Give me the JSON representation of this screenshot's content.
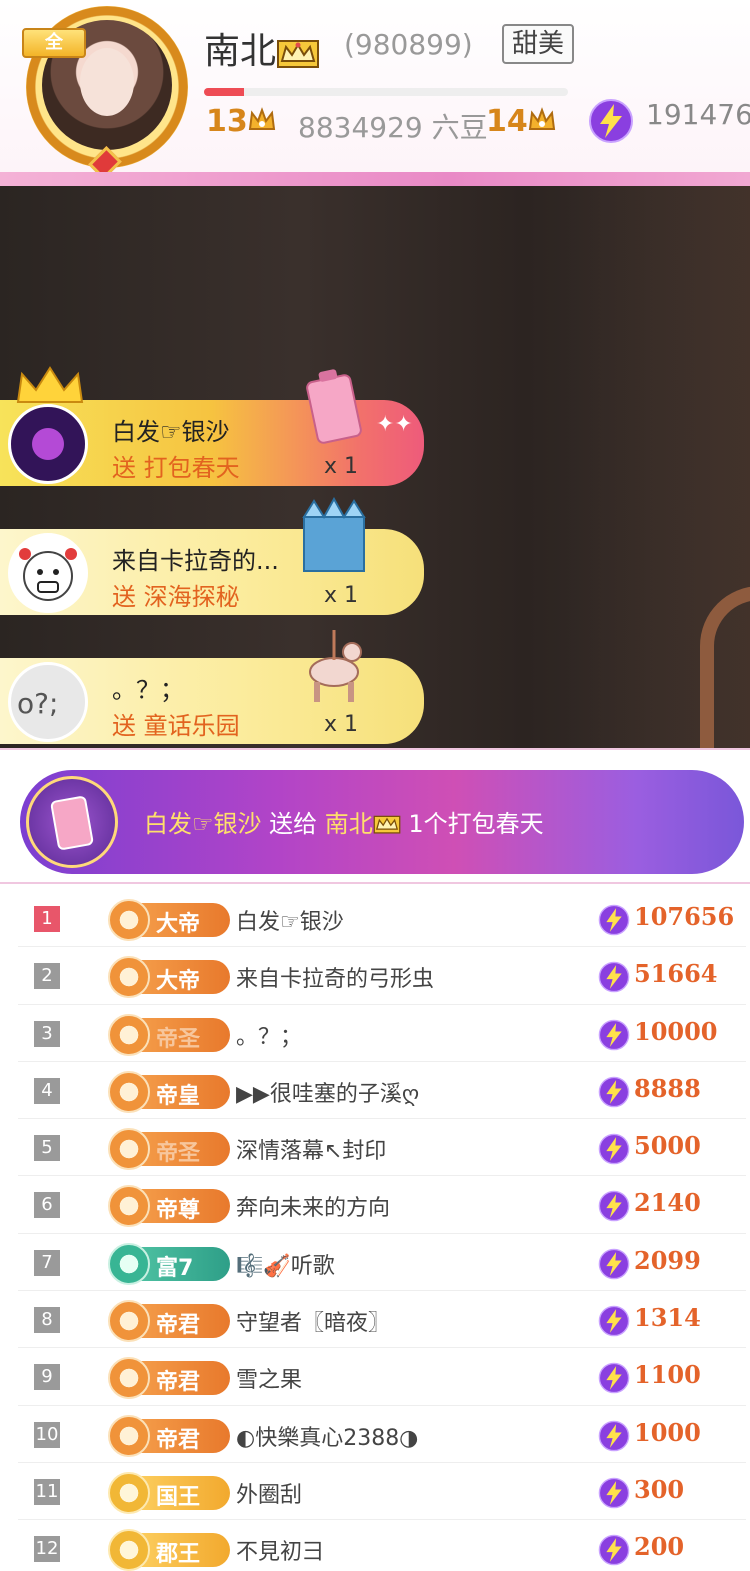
{
  "header": {
    "avatar_badge": "全",
    "host_name": "南北",
    "host_id": "(980899)",
    "tag": "甜美",
    "progress_fraction": 0.11,
    "level_current": "13",
    "beans": "8834929 六豆",
    "level_next": "14",
    "lightning_count": "191476"
  },
  "gift_feed": [
    {
      "user": "白发☞银沙",
      "action": "送 打包春天",
      "count": "x 1",
      "avatar": "user-avatar-purple"
    },
    {
      "user": "来自卡拉奇的...",
      "action": "送 深海探秘",
      "count": "x 1",
      "avatar": "user-avatar-cartoon"
    },
    {
      "user": "。？；",
      "action": "送 童话乐园",
      "count": "x 1",
      "avatar": "user-avatar-text"
    }
  ],
  "banner": {
    "sender": "白发☞银沙",
    "verb": " 送给 ",
    "receiver": "南北",
    "gift": " 1个打包春天"
  },
  "ranking": [
    {
      "rank": "1",
      "badge": "大帝",
      "badge_style": "orange",
      "name": "白发☞银沙",
      "score": "107656"
    },
    {
      "rank": "2",
      "badge": "大帝",
      "badge_style": "orange",
      "name": "来自卡拉奇的弓形虫",
      "score": "51664"
    },
    {
      "rank": "3",
      "badge": "帝圣",
      "badge_style": "orange-pale",
      "name": "。？；",
      "score": "10000"
    },
    {
      "rank": "4",
      "badge": "帝皇",
      "badge_style": "orange",
      "name": "▶▶很哇塞的子溪ღ",
      "score": "8888"
    },
    {
      "rank": "5",
      "badge": "帝圣",
      "badge_style": "orange-pale",
      "name": "深情落幕↖封印",
      "score": "5000"
    },
    {
      "rank": "6",
      "badge": "帝尊",
      "badge_style": "orange",
      "name": "奔向未来的方向",
      "score": "2140"
    },
    {
      "rank": "7",
      "badge": "富7",
      "badge_style": "green",
      "name": "🎼🎻听歌",
      "score": "2099"
    },
    {
      "rank": "8",
      "badge": "帝君",
      "badge_style": "orange",
      "name": "守望者〖暗夜〗",
      "score": "1314"
    },
    {
      "rank": "9",
      "badge": "帝君",
      "badge_style": "orange",
      "name": "雪之果",
      "score": "1100"
    },
    {
      "rank": "10",
      "badge": "帝君",
      "badge_style": "orange",
      "name": "◐快樂真心2388◑",
      "score": "1000"
    },
    {
      "rank": "11",
      "badge": "国王",
      "badge_style": "gold",
      "name": "外圈刮",
      "score": "300"
    },
    {
      "rank": "12",
      "badge": "郡王",
      "badge_style": "gold",
      "name": "不見初彐",
      "score": "200"
    }
  ],
  "colors": {
    "accent_orange": "#e4632a",
    "lightning_purple": "#8a3fe0",
    "rank_first": "#e8566a",
    "banner_gradient_start": "#7b3fd1",
    "banner_gradient_end": "#7a57d9"
  },
  "icons": [
    "crown-icon",
    "lightning-icon",
    "gift-icon",
    "sparkle-icon"
  ]
}
